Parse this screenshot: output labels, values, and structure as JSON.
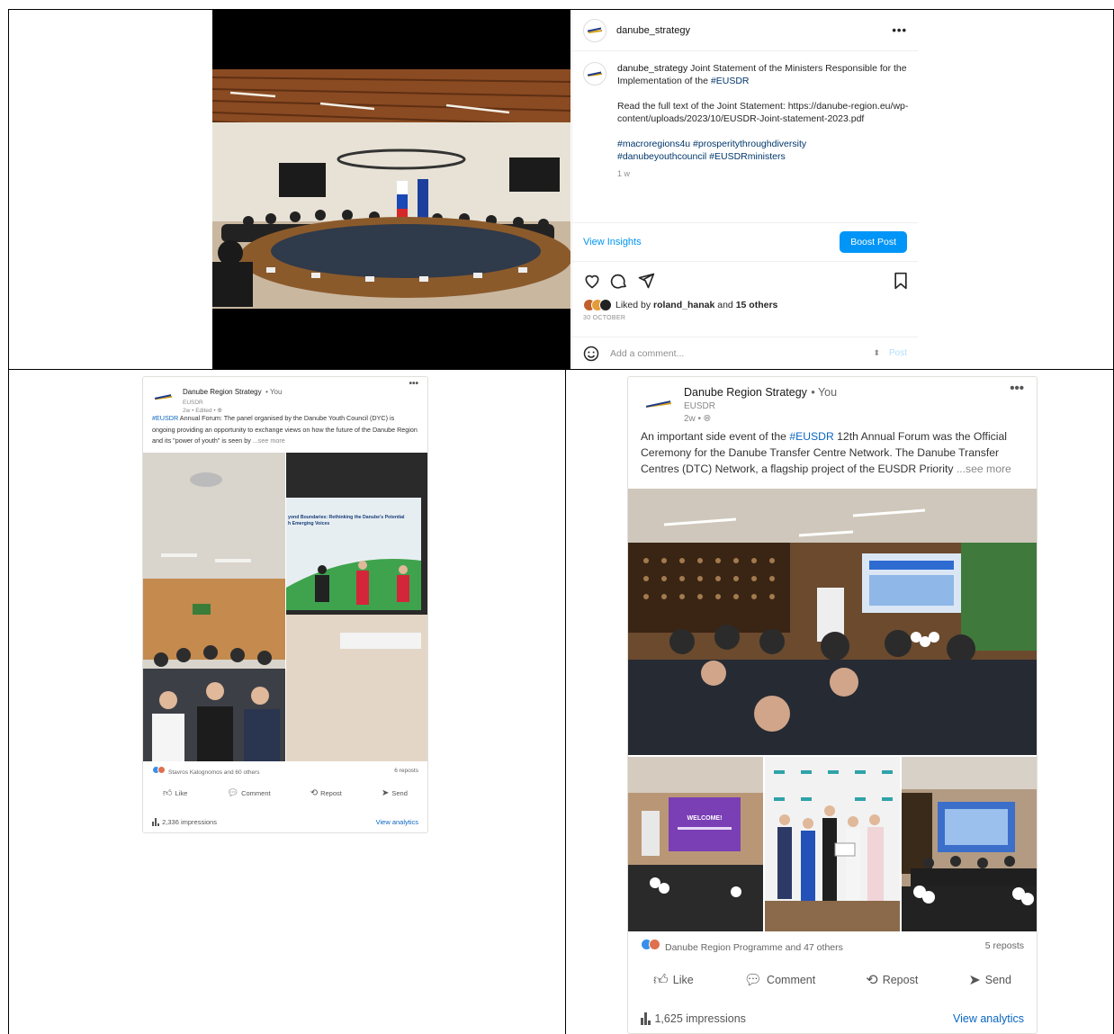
{
  "instagram": {
    "username": "danube_strategy",
    "more": "•••",
    "caption": {
      "user": "danube_strategy",
      "text": "Joint Statement of the Ministers Responsible for the Implementation of the",
      "tag": "#EUSDR",
      "link_text": "Read the full text of the Joint Statement: https://danube-region.eu/wp-content/uploads/2023/10/EUSDR-Joint-statement-2023.pdf",
      "hashtags_line1": "#macroregions4u #prosperitythroughdiversity",
      "hashtags_line2": "#danubeyouthcouncil #EUSDRministers",
      "time": "1 w"
    },
    "view_insights": "View Insights",
    "boost_post": "Boost Post",
    "liked_by_prefix": "Liked by",
    "liked_by_user": "roland_hanak",
    "liked_by_and": "and",
    "liked_by_others": "15 others",
    "date": "30 OCTOBER",
    "comment_placeholder": "Add a comment...",
    "post_label": "Post",
    "icons": [
      "heart-icon",
      "comment-icon",
      "share-icon",
      "bookmark-icon",
      "emoji-icon"
    ]
  },
  "linkedin_1": {
    "name": "Danube Region Strategy",
    "you": "• You",
    "org": "EUSDR",
    "meta": "2w • Edited •",
    "tag": "#EUSDR",
    "text": "Annual Forum: The panel organised by the Danube Youth Council (DYC) is ongoing providing an opportunity to exchange views on how the future of the Danube Region and its \"power of youth\" is seen by",
    "see_more": "...see more",
    "photo_banner_line1": "yond Boundaries: Rethinking the Danube's Potential",
    "photo_banner_line2": "h Emerging Voices",
    "reactions": "Stavros Kalognomos and 60 others",
    "reposts": "6 reposts",
    "actions": {
      "like": "Like",
      "comment": "Comment",
      "repost": "Repost",
      "send": "Send"
    },
    "impressions": "2,336 impressions",
    "view_analytics": "View analytics",
    "more": "•••"
  },
  "linkedin_2": {
    "name": "Danube Region Strategy",
    "you": "• You",
    "org": "EUSDR",
    "meta": "2w •",
    "text_before": "An important side event of the",
    "tag": "#EUSDR",
    "text_after": "12th Annual Forum was the Official Ceremony for the Danube Transfer Centre Network.  The Danube Transfer Centres (DTC) Network, a flagship project of the EUSDR Priority",
    "see_more": "...see more",
    "photo_welcome": "WELCOME!",
    "reactions": "Danube Region Programme and 47 others",
    "reposts": "5 reposts",
    "actions": {
      "like": "Like",
      "comment": "Comment",
      "repost": "Repost",
      "send": "Send"
    },
    "impressions": "1,625 impressions",
    "view_analytics": "View analytics",
    "more": "•••"
  },
  "colors": {
    "instagram_blue": "#0095f6",
    "linkedin_blue": "#0a66c2",
    "hashtag": "#00376b"
  }
}
